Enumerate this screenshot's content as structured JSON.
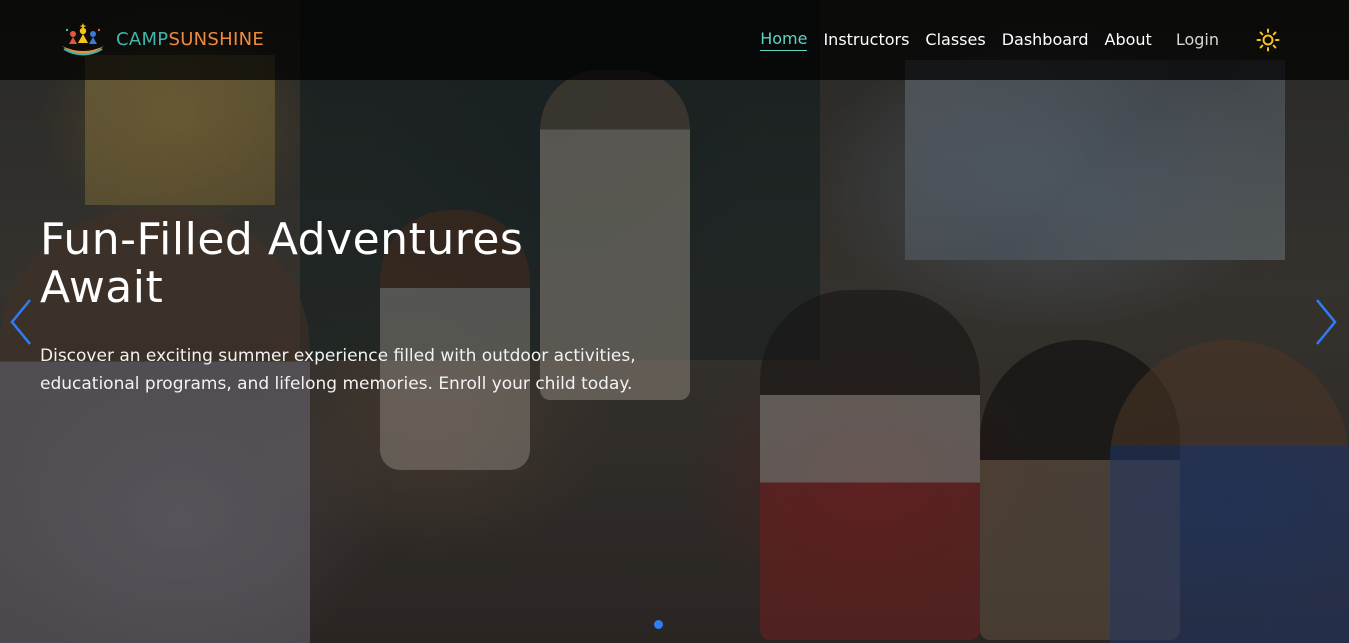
{
  "brand": {
    "camp": "CAMP",
    "sunshine": "SUNSHINE",
    "logo_icon": "family-sun-logo-icon"
  },
  "nav": {
    "items": [
      {
        "label": "Home",
        "active": true
      },
      {
        "label": "Instructors",
        "active": false
      },
      {
        "label": "Classes",
        "active": false
      },
      {
        "label": "Dashboard",
        "active": false
      },
      {
        "label": "About",
        "active": false
      }
    ],
    "login": "Login",
    "theme_icon": "sun-icon"
  },
  "hero": {
    "title": "Fun-Filled Adventures Await",
    "description": "Discover an exciting summer experience filled with outdoor activities, educational programs, and lifelong memories. Enroll your child today.",
    "background": "classroom-photo"
  },
  "carousel": {
    "prev_icon": "chevron-left-icon",
    "next_icon": "chevron-right-icon",
    "slide_count": 1,
    "active_slide": 1
  },
  "colors": {
    "brand_teal": "#3fb6a8",
    "brand_orange": "#f08a3c",
    "active_link": "#5fd4c4",
    "arrow_blue": "#2f7df6",
    "sun_yellow": "#f5c518"
  }
}
